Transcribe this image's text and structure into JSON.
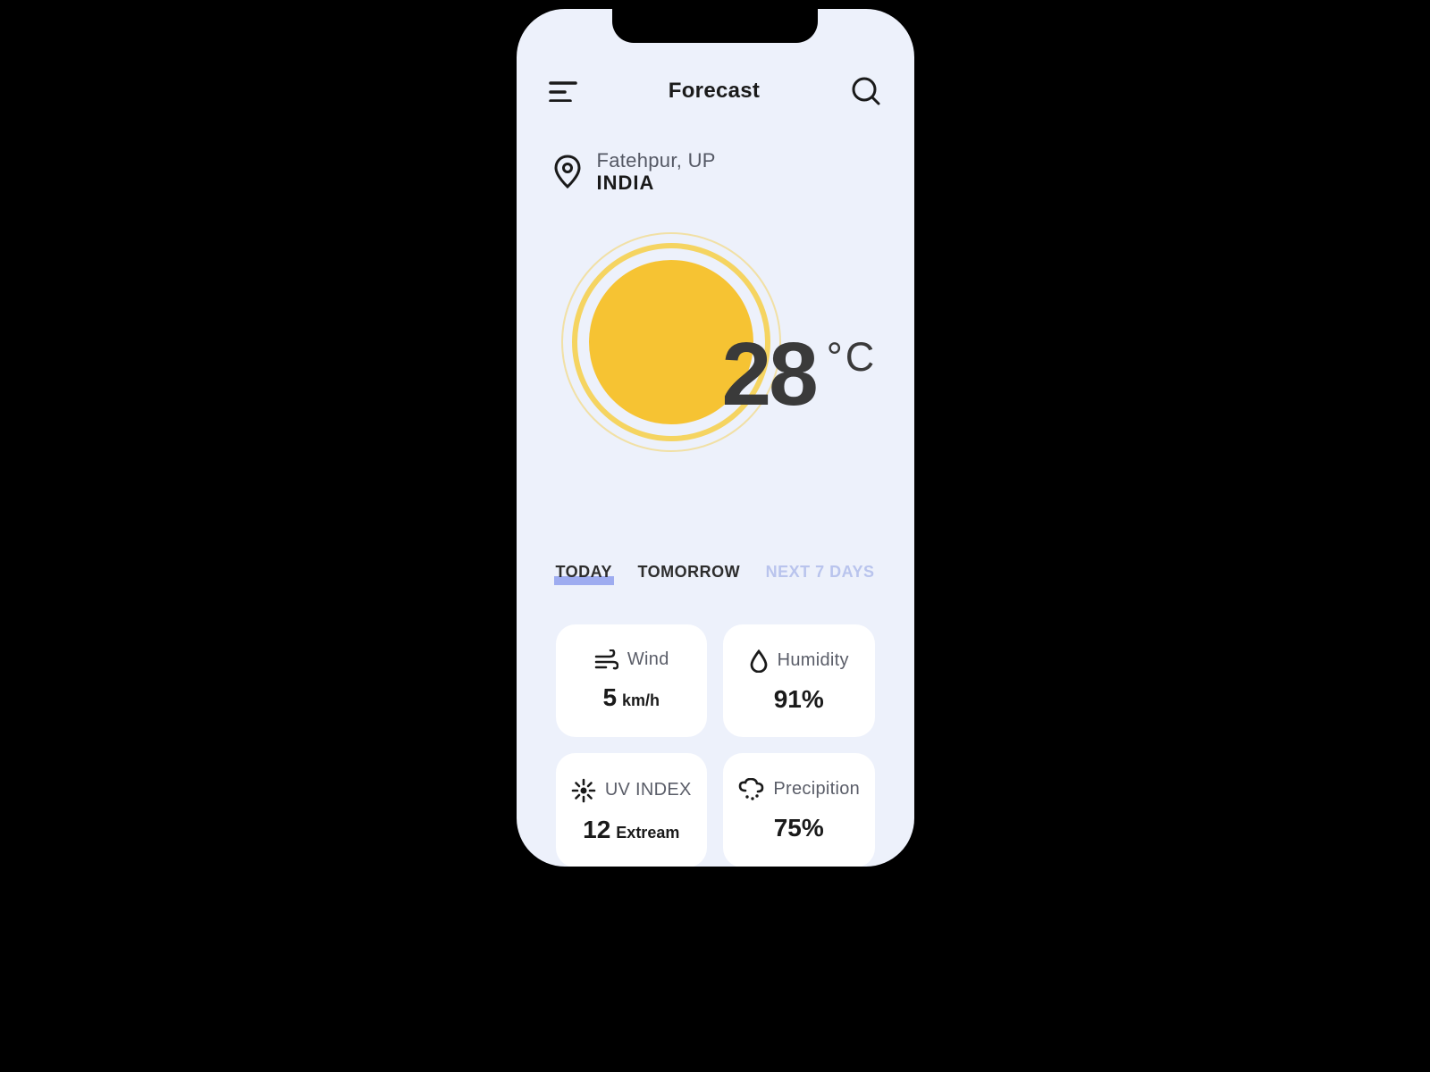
{
  "header": {
    "title": "Forecast"
  },
  "location": {
    "city": "Fatehpur, UP",
    "country": "INDIA"
  },
  "current": {
    "temp": "28",
    "unit": "°C"
  },
  "tabs": {
    "today": "TODAY",
    "tomorrow": "TOMORROW",
    "next7": "NEXT 7 DAYS"
  },
  "cards": {
    "wind": {
      "label": "Wind",
      "value": "5",
      "unit": "km/h"
    },
    "hum": {
      "label": "Humidity",
      "value": "91%"
    },
    "uv": {
      "label": "UV INDEX",
      "value": "12",
      "unit": "Extream"
    },
    "precip": {
      "label": "Precipition",
      "value": "75%"
    }
  }
}
